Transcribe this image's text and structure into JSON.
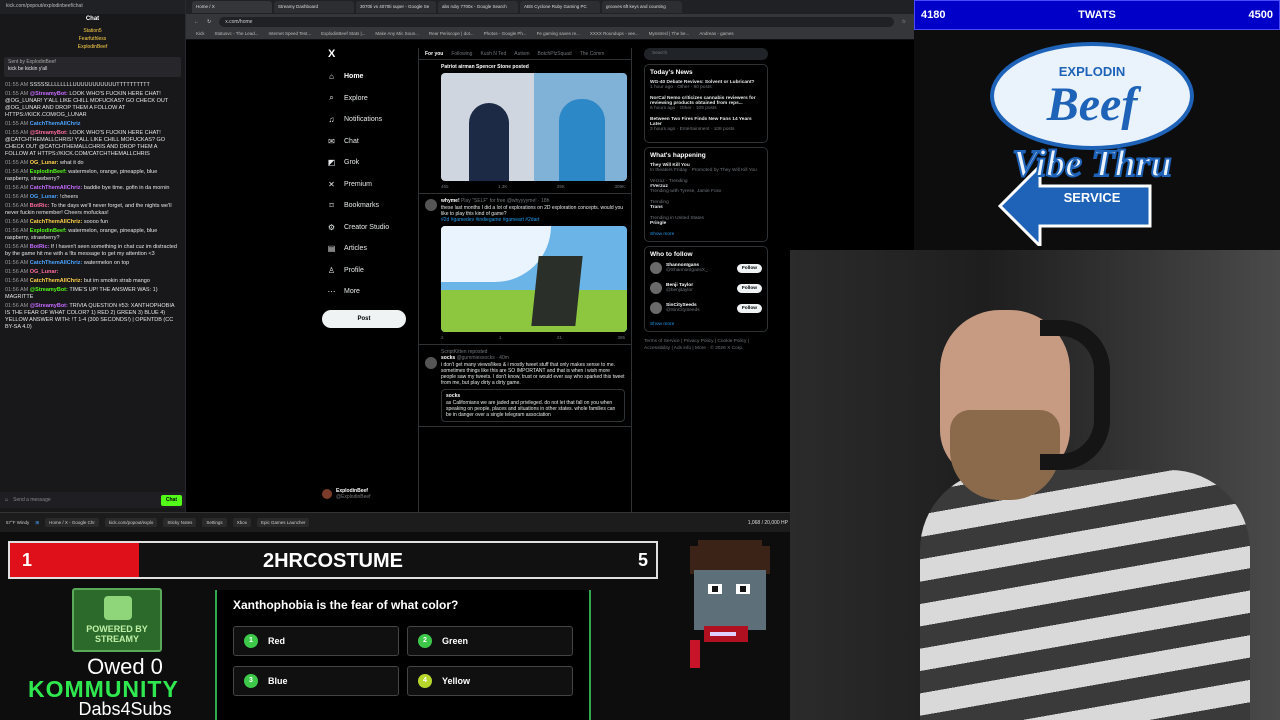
{
  "chat_panel": {
    "url": "kick.com/popout/explodinbeef/chat",
    "header": "Chat",
    "leaderboard": [
      "Station5",
      "Fearfuthless",
      "ExplodinBeef"
    ],
    "pinned_label": "Sent by ExplodinBeef",
    "pinned_text": "kick be kickin y'all",
    "messages": [
      {
        "time": "01:55 AM",
        "user": "",
        "text": "SSSSSLLLLLLLLUUUUUUUUUUUTTTTTTTTTT"
      },
      {
        "time": "01:55 AM",
        "user": "@StreamyBot:",
        "text": "LOOK WHO'S FUCKIN HERE CHAT! @OG_LUNAR! Y'ALL LIKE CHILL MOFUCKAS? GO CHECK OUT @OG_LUNAR AND DROP THEM A FOLLOW AT HTTPS://KICK.COM/OG_LUNAR"
      },
      {
        "time": "01:55 AM",
        "user": "CatchThemAllChriz",
        "text": ""
      },
      {
        "time": "01:55 AM",
        "user": "@StreamyBot:",
        "text": "LOOK WHO'S FUCKIN HERE CHAT! @CATCHTHEMALLCHRIS! Y'ALL LIKE CHILL MOFUCKAS? GO CHECK OUT @CATCHTHEMALLCHRIS AND DROP THEM A FOLLOW AT HTTPS://KICK.COM/CATCHTHEMALLCHRIS"
      },
      {
        "time": "01:55 AM",
        "user": "OG_Lunar:",
        "text": "what it do"
      },
      {
        "time": "01:56 AM",
        "user": "ExplodinBeef:",
        "text": "watermelon, orange, pineapple, blue raspberry, strawberry?"
      },
      {
        "time": "01:56 AM",
        "user": "CatchThemAllChriz:",
        "text": "baddie bye time. gofin in da mornin"
      },
      {
        "time": "01:56 AM",
        "user": "OG_Lunar:",
        "text": "!cheers"
      },
      {
        "time": "01:56 AM",
        "user": "BotRic:",
        "text": "To the days we'll never forget, and the nights we'll never fuckin remember! Cheers mofuckas!"
      },
      {
        "time": "01:56 AM",
        "user": "CatchThemAllChriz:",
        "text": "soooo fun"
      },
      {
        "time": "01:56 AM",
        "user": "ExplodinBeef:",
        "text": "watermelon, orange, pineapple, blue raspberry, strawberry?"
      },
      {
        "time": "01:56 AM",
        "user": "BotRic:",
        "text": "If I haven't seen something in chat cuz im distracted by the game hit me with a !lts message to get my attention <3"
      },
      {
        "time": "01:56 AM",
        "user": "CatchThemAllChriz:",
        "text": "watermelon on top"
      },
      {
        "time": "01:56 AM",
        "user": "OG_Lunar:",
        "text": ""
      },
      {
        "time": "01:56 AM",
        "user": "CatchThemAllChriz:",
        "text": "but im smokin strab mango"
      },
      {
        "time": "01:56 AM",
        "user": "@StreamyBot:",
        "text": "TIME'S UP! THE ANSWER WAS: 1) MAGRITTE"
      },
      {
        "time": "01:56 AM",
        "user": "@StreamyBot:",
        "text": "TRIVIA QUESTION #53: XANTHOPHOBIA IS THE FEAR OF WHAT COLOR? 1) RED 2) GREEN 3) BLUE 4) YELLOW ANSWER WITH: !T 1-4 (300 SECONDS!) | OPENTDB (CC BY-SA 4.0)"
      }
    ],
    "send_placeholder": "Send a message",
    "send_button": "Chat"
  },
  "browser": {
    "tabs": [
      "Home / X",
      "Streamy Dashboard",
      "3070ti vs 4070ti super - Google Se",
      "abs ruby 7700x - Google Search",
      "ABS Cyclone Ruby Gaming PC",
      "grooves 6ft keys and counting"
    ],
    "url": "x.com/home",
    "bookmarks": [
      "Kick",
      "Statusvc - The Lead...",
      "Internet Speed Test...",
      "ExplodinBeef Stats |...",
      "Make Any Mic Soun...",
      "Rear Periscope | dot...",
      "Photos - Google Ph...",
      "Fe gaming saves re...",
      "XXXX Roundups - vee...",
      "Mynstrecl | The be...",
      "Andreas - games"
    ],
    "nav": [
      {
        "label": "Home",
        "icon": "home-icon",
        "glyph": "⌂"
      },
      {
        "label": "Explore",
        "icon": "search-icon",
        "glyph": "⌕"
      },
      {
        "label": "Notifications",
        "icon": "bell-icon",
        "glyph": "♫"
      },
      {
        "label": "Chat",
        "icon": "chat-icon",
        "glyph": "✉"
      },
      {
        "label": "Grok",
        "icon": "grok-icon",
        "glyph": "◩"
      },
      {
        "label": "Premium",
        "icon": "premium-icon",
        "glyph": "✕"
      },
      {
        "label": "Bookmarks",
        "icon": "bookmark-icon",
        "glyph": "⌑"
      },
      {
        "label": "Creator Studio",
        "icon": "creator-icon",
        "glyph": "⚙"
      },
      {
        "label": "Articles",
        "icon": "articles-icon",
        "glyph": "▤"
      },
      {
        "label": "Profile",
        "icon": "profile-icon",
        "glyph": "♙"
      },
      {
        "label": "More",
        "icon": "more-icon",
        "glyph": "⋯"
      }
    ],
    "x_logo": "X",
    "post_button": "Post",
    "account_name": "ExplodinBeef",
    "account_handle": "@ExplodinBeef",
    "feed_tabs": [
      "For you",
      "Following",
      "Kush N Ted",
      "Autism",
      "BotchPlzSquad",
      "The Comm"
    ],
    "posts": [
      {
        "header": "Patriot airman Spencer Stone posted",
        "stats": [
          "465",
          "1.3K",
          "25K",
          "309K"
        ]
      },
      {
        "author": "whyme!",
        "handle": "@whyyyyme! · 18h",
        "title": "Play \"SELF\" for free",
        "text": "these last months I did a lot of explorations on 2D exploration concepts. would you like to play this kind of game?",
        "tags": "#2d #gamedev #indiegame #gameart #2dart",
        "stats": [
          "2",
          "1",
          "21",
          "395"
        ]
      },
      {
        "reposter": "ScriptKitten reposted",
        "author": "socks",
        "handle": "@gummiessocks · 40m",
        "text": "i don't get many views/likes & i mostly tweet stuff that only makes sense to me. sometimes things like this are SO IMPORTANT and that is when i wish more people saw my tweets. I don't know, trust or would ever say who sparked this tweet from me, but play dirty a dirty game.",
        "quote_author": "socks",
        "quote_text": "as Californians we are jaded and privileged. do not let that fall on you when speaking on people, places and situations in other states. whole families can be in danger over a single telegram association"
      }
    ],
    "sidebar": {
      "search_placeholder": "Search",
      "news_title": "Today's News",
      "news": [
        {
          "headline": "WG-40 Debate Revives: Solvent or Lubricant?",
          "meta": "1 hour ago · Other · 90 posts"
        },
        {
          "headline": "NorCal Nemo criticizes cannabis reviewers for reviewing products obtained from reps...",
          "meta": "6 hours ago · Other · 105 posts"
        },
        {
          "headline": "Between Two Fires Finds New Fans 14 Years Later",
          "meta": "3 hours ago · Entertainment · 108 posts"
        }
      ],
      "happening_title": "What's happening",
      "trends": [
        {
          "context": "",
          "name": "They Will Kill You",
          "meta": "In theaters Friday · Promoted by They Will Kill You"
        },
        {
          "context": "Verzuz · Trending",
          "name": "#Verzuz",
          "meta": "Trending with Tyrese, Jamie Foxx"
        },
        {
          "context": "Trending",
          "name": "Trans",
          "meta": ""
        },
        {
          "context": "Trending in United States",
          "name": "Pringle",
          "meta": ""
        }
      ],
      "show_more": "Show more",
      "wtf_title": "Who to follow",
      "follow": [
        {
          "name": "ShannonIgans",
          "handle": "@ShannonIgansX_"
        },
        {
          "name": "Benji Taylor",
          "handle": "@benjitaylor"
        },
        {
          "name": "SinCitySeeds",
          "handle": "@SinCitySeeds"
        }
      ],
      "follow_button": "Follow",
      "legal": "Terms of Service | Privacy Policy | Cookie Policy | Accessibility | Ads info | More · © 2026 X Corp."
    },
    "taskbar_weather": "57°F Windy",
    "taskbar_apps": [
      "Home / X - Google Chr",
      "kick.com/popout/explo",
      "Sticky Notes",
      "Settings",
      "Xbox",
      "Epic Games Launcher"
    ],
    "hp": "1,068 / 20,000 HP"
  },
  "overlay": {
    "top_left_value": "4180",
    "top_center_label": "TWATS",
    "top_right_value": "4500",
    "logo_line1": "EXPLODIN",
    "logo_line2": "Beef",
    "logo_line3": "Vibe Thru",
    "logo_line4": "SERVICE",
    "progress_current": "1",
    "progress_label": "2HRCOSTUME",
    "progress_goal": "5",
    "progress_fraction": 0.2,
    "streamy_text": "POWERED BY STREAMY",
    "owed": "Owed 0",
    "kommunity": "KOMMUNITY",
    "dabs": "Dabs4Subs"
  },
  "trivia": {
    "question": "Xanthophobia is the fear of what color?",
    "options": [
      {
        "num": "1",
        "label": "Red"
      },
      {
        "num": "2",
        "label": "Green"
      },
      {
        "num": "3",
        "label": "Blue"
      },
      {
        "num": "4",
        "label": "Yellow"
      }
    ]
  },
  "colors": {
    "kick_green": "#53fc18",
    "overlay_blue": "#0000c8",
    "progress_red": "#e0101a",
    "x_blue": "#1d9bf0"
  }
}
